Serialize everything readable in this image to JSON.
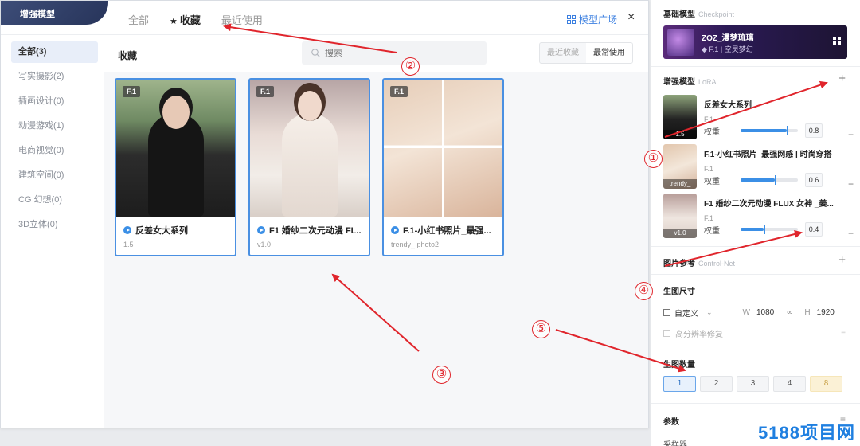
{
  "modal": {
    "title": "增强模型",
    "tabs": [
      {
        "label": "全部",
        "active": false
      },
      {
        "label": "收藏",
        "active": true
      },
      {
        "label": "最近使用",
        "active": false
      }
    ],
    "market_link": "模型广场",
    "close": "×"
  },
  "sidebar": {
    "categories": [
      {
        "label": "全部(3)",
        "active": true
      },
      {
        "label": "写实摄影(2)"
      },
      {
        "label": "插画设计(0)"
      },
      {
        "label": "动漫游戏(1)"
      },
      {
        "label": "电商视觉(0)"
      },
      {
        "label": "建筑空间(0)"
      },
      {
        "label": "CG 幻想(0)"
      },
      {
        "label": "3D立体(0)"
      }
    ]
  },
  "content": {
    "title": "收藏",
    "search_placeholder": "搜索",
    "sort": [
      "最近收藏",
      "最常使用"
    ],
    "cards": [
      {
        "badge": "F.1",
        "title": "反差女大系列",
        "sub": "1.5"
      },
      {
        "badge": "F.1",
        "title": "F1 婚纱二次元动漫 FL...",
        "sub": "v1.0"
      },
      {
        "badge": "F.1",
        "title": "F.1-小红书照片_最强...",
        "sub": "trendy_ photo2"
      }
    ]
  },
  "right": {
    "base_model": {
      "label": "基础模型",
      "label_en": "Checkpoint",
      "name": "ZOZ_漫梦琉璃",
      "meta": "F.1 | 空灵梦幻"
    },
    "lora": {
      "label": "增强模型",
      "label_en": "LoRA",
      "weight_label": "权重",
      "items": [
        {
          "name": "反差女大系列",
          "ver": "F.1",
          "tag": "1.5",
          "weight": "0.8",
          "fill": 0.8
        },
        {
          "name": "F.1-小红书照片_最强网感 | 时尚穿搭",
          "ver": "F.1",
          "tag": "trendy_",
          "weight": "0.6",
          "fill": 0.6
        },
        {
          "name": "F1 婚纱二次元动漫 FLUX 女神 _姜...",
          "ver": "F.1",
          "tag": "v1.0",
          "weight": "0.4",
          "fill": 0.4
        }
      ]
    },
    "control": {
      "label": "图片参考",
      "label_en": "Control-Net"
    },
    "size": {
      "label": "生图尺寸",
      "mode": "自定义",
      "w_label": "W",
      "w": "1080",
      "h_label": "H",
      "h": "1920",
      "hires": "高分辨率修复"
    },
    "count": {
      "label": "生图数量",
      "options": [
        "1",
        "2",
        "3",
        "4",
        "8"
      ]
    },
    "params": {
      "label": "参数",
      "sampler": "采样器"
    }
  },
  "annotations": [
    "①",
    "②",
    "③",
    "④",
    "⑤"
  ],
  "watermark": "5188项目网",
  "colors": {
    "accent": "#3b8fe6",
    "arrow": "#e0252c",
    "watermark": "#1f7fe0"
  }
}
